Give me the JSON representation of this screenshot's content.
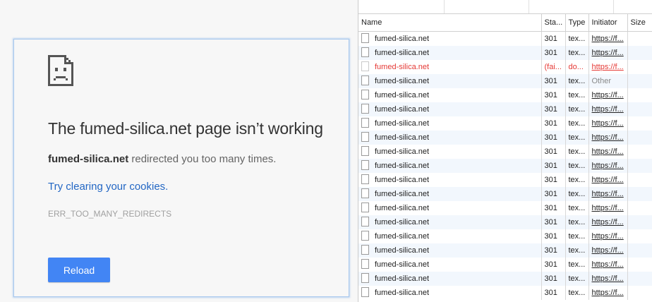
{
  "error_page": {
    "title": "The fumed-silica.net page isn’t working",
    "summary_host": "fumed-silica.net",
    "summary_rest": " redirected you too many times.",
    "suggestion": "Try clearing your cookies.",
    "error_code": "ERR_TOO_MANY_REDIRECTS",
    "reload_label": "Reload",
    "icon": "sad-document-icon",
    "accent_color": "#4285f4",
    "link_color": "#2367c4"
  },
  "network": {
    "columns": [
      "Name",
      "Sta...",
      "Type",
      "Initiator",
      "Size"
    ],
    "failed_color": "#e53935",
    "rows": [
      {
        "name": "fumed-silica.net",
        "status": "301",
        "type": "tex...",
        "initiator": "https://f...",
        "size": "",
        "failed": false
      },
      {
        "name": "fumed-silica.net",
        "status": "301",
        "type": "tex...",
        "initiator": "https://f...",
        "size": "",
        "failed": false
      },
      {
        "name": "fumed-silica.net",
        "status": "(fai...",
        "type": "do...",
        "initiator": "https://f...",
        "size": "",
        "failed": true
      },
      {
        "name": "fumed-silica.net",
        "status": "301",
        "type": "tex...",
        "initiator": "Other",
        "size": "",
        "failed": false
      },
      {
        "name": "fumed-silica.net",
        "status": "301",
        "type": "tex...",
        "initiator": "https://f...",
        "size": "",
        "failed": false
      },
      {
        "name": "fumed-silica.net",
        "status": "301",
        "type": "tex...",
        "initiator": "https://f...",
        "size": "",
        "failed": false
      },
      {
        "name": "fumed-silica.net",
        "status": "301",
        "type": "tex...",
        "initiator": "https://f...",
        "size": "",
        "failed": false
      },
      {
        "name": "fumed-silica.net",
        "status": "301",
        "type": "tex...",
        "initiator": "https://f...",
        "size": "",
        "failed": false
      },
      {
        "name": "fumed-silica.net",
        "status": "301",
        "type": "tex...",
        "initiator": "https://f...",
        "size": "",
        "failed": false
      },
      {
        "name": "fumed-silica.net",
        "status": "301",
        "type": "tex...",
        "initiator": "https://f...",
        "size": "",
        "failed": false
      },
      {
        "name": "fumed-silica.net",
        "status": "301",
        "type": "tex...",
        "initiator": "https://f...",
        "size": "",
        "failed": false
      },
      {
        "name": "fumed-silica.net",
        "status": "301",
        "type": "tex...",
        "initiator": "https://f...",
        "size": "",
        "failed": false
      },
      {
        "name": "fumed-silica.net",
        "status": "301",
        "type": "tex...",
        "initiator": "https://f...",
        "size": "",
        "failed": false
      },
      {
        "name": "fumed-silica.net",
        "status": "301",
        "type": "tex...",
        "initiator": "https://f...",
        "size": "",
        "failed": false
      },
      {
        "name": "fumed-silica.net",
        "status": "301",
        "type": "tex...",
        "initiator": "https://f...",
        "size": "",
        "failed": false
      },
      {
        "name": "fumed-silica.net",
        "status": "301",
        "type": "tex...",
        "initiator": "https://f...",
        "size": "",
        "failed": false
      },
      {
        "name": "fumed-silica.net",
        "status": "301",
        "type": "tex...",
        "initiator": "https://f...",
        "size": "",
        "failed": false
      },
      {
        "name": "fumed-silica.net",
        "status": "301",
        "type": "tex...",
        "initiator": "https://f...",
        "size": "",
        "failed": false
      },
      {
        "name": "fumed-silica.net",
        "status": "301",
        "type": "tex...",
        "initiator": "https://f...",
        "size": "",
        "failed": false
      }
    ]
  }
}
